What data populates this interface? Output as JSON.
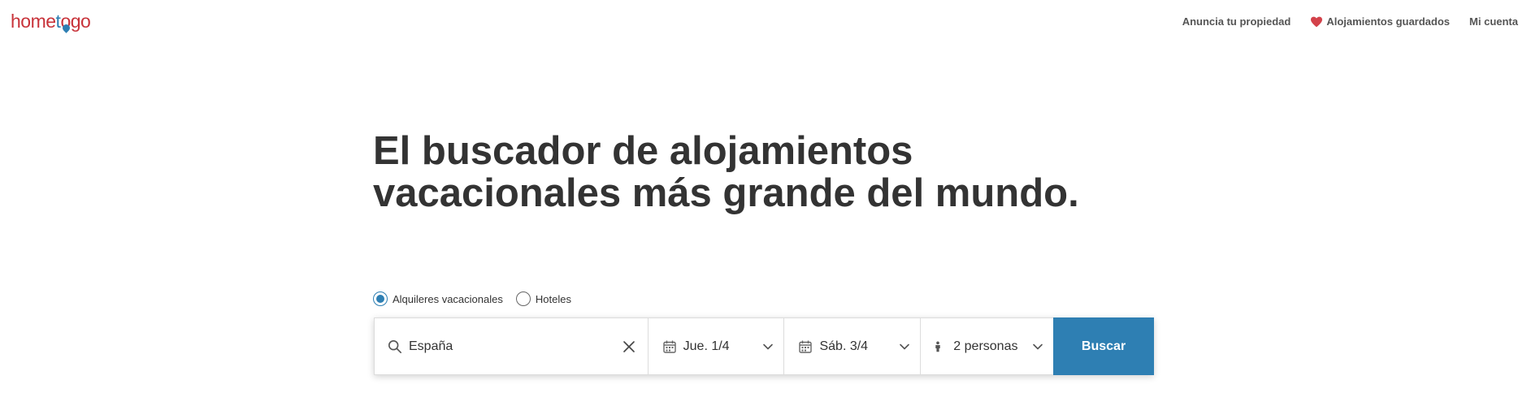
{
  "header": {
    "logo_text_a": "home",
    "logo_text_b": "t",
    "logo_text_c": "go",
    "brand_color": "#c8333a",
    "accent_color": "#2e7fb3",
    "nav": {
      "list_property": "Anuncia tu propiedad",
      "saved": "Alojamientos guardados",
      "account": "Mi cuenta"
    }
  },
  "hero": {
    "title_line1": "El buscador de alojamientos",
    "title_line2": "vacacionales más grande del mundo."
  },
  "search": {
    "type_options": [
      {
        "label": "Alquileres vacacionales",
        "selected": true
      },
      {
        "label": "Hoteles",
        "selected": false
      }
    ],
    "destination": "España",
    "checkin": "Jue. 1/4",
    "checkout": "Sáb. 3/4",
    "guests": "2 personas",
    "button": "Buscar"
  },
  "icons": {
    "saved": "heart-icon",
    "destination": "search-icon",
    "clear": "close-icon",
    "date": "calendar-icon",
    "dropdown": "chevron-down-icon",
    "guests": "person-icon"
  }
}
